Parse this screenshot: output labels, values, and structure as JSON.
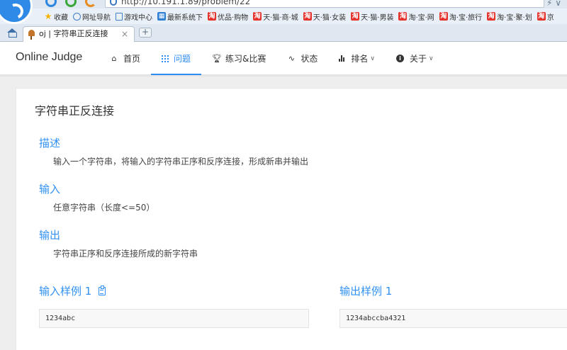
{
  "browser": {
    "url": "http://10.191.1.89/problem/22",
    "bookmarks": [
      {
        "label": "收藏",
        "icon": "star-icon"
      },
      {
        "label": "网址导航",
        "icon": "globe-icon"
      },
      {
        "label": "游戏中心",
        "icon": "doc-icon"
      },
      {
        "label": "最新系统下",
        "icon": "tile-icon"
      },
      {
        "label": "优品·购物",
        "icon": "taobao-icon"
      },
      {
        "label": "天·猫·商·城",
        "icon": "taobao-icon"
      },
      {
        "label": "天·猫·女装",
        "icon": "taobao-icon"
      },
      {
        "label": "天·猫·男装",
        "icon": "taobao-icon"
      },
      {
        "label": "淘·宝·网",
        "icon": "taobao-icon"
      },
      {
        "label": "淘·宝·旅行",
        "icon": "taobao-icon"
      },
      {
        "label": "淘·宝·聚·划",
        "icon": "taobao-icon"
      },
      {
        "label": "京",
        "icon": "taobao-icon"
      }
    ],
    "tab": {
      "title": "oj | 字符串正反连接",
      "close": "×"
    },
    "new_tab": "+"
  },
  "navbar": {
    "brand": "Online Judge",
    "items": [
      {
        "label": "首页",
        "icon": "home-icon",
        "active": false
      },
      {
        "label": "问题",
        "icon": "grid-icon",
        "active": true
      },
      {
        "label": "练习&比赛",
        "icon": "trophy-icon",
        "active": false
      },
      {
        "label": "状态",
        "icon": "pulse-icon",
        "active": false
      },
      {
        "label": "排名",
        "icon": "bar-chart-icon",
        "active": false,
        "dropdown": true
      },
      {
        "label": "关于",
        "icon": "info-icon",
        "active": false,
        "dropdown": true
      }
    ]
  },
  "problem": {
    "title": "字符串正反连接",
    "description_label": "描述",
    "description": "输入一个字符串，将输入的字符串正序和反序连接，形成新串并输出",
    "input_label": "输入",
    "input": "任意字符串（长度<=50）",
    "output_label": "输出",
    "output": "字符串正序和反序连接所成的新字符串",
    "sample_input_label": "输入样例 1",
    "sample_input": "1234abc",
    "sample_output_label": "输出样例 1",
    "sample_output": "1234abccba4321"
  },
  "colors": {
    "accent": "#2d8cf0",
    "section_title": "#3091f2"
  }
}
